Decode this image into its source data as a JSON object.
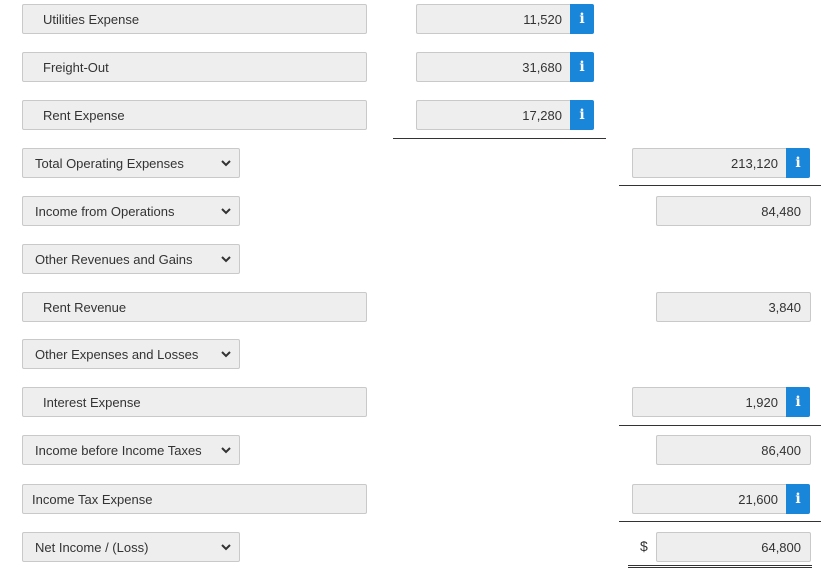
{
  "rows": [
    {
      "label": "Utilities Expense",
      "mid_value": "11,520"
    },
    {
      "label": "Freight-Out",
      "mid_value": "31,680"
    },
    {
      "label": "Rent Expense",
      "mid_value": "17,280"
    },
    {
      "label": "Total Operating Expenses",
      "right_value": "213,120"
    },
    {
      "label": "Income from Operations",
      "right_value": "84,480"
    },
    {
      "label": "Other Revenues and Gains"
    },
    {
      "label": "Rent Revenue",
      "right_value": "3,840"
    },
    {
      "label": "Other Expenses and Losses"
    },
    {
      "label": "Interest Expense",
      "right_value": "1,920"
    },
    {
      "label": "Income before Income Taxes",
      "right_value": "86,400"
    },
    {
      "label": "Income Tax Expense",
      "right_value": "21,600"
    },
    {
      "label": "Net Income / (Loss)",
      "right_value": "64,800"
    }
  ],
  "info_icon": "i",
  "currency_symbol": "$",
  "colors": {
    "info_button": "#1a86d9",
    "field_bg": "#eeeeee",
    "field_border": "#c9c9c9"
  }
}
